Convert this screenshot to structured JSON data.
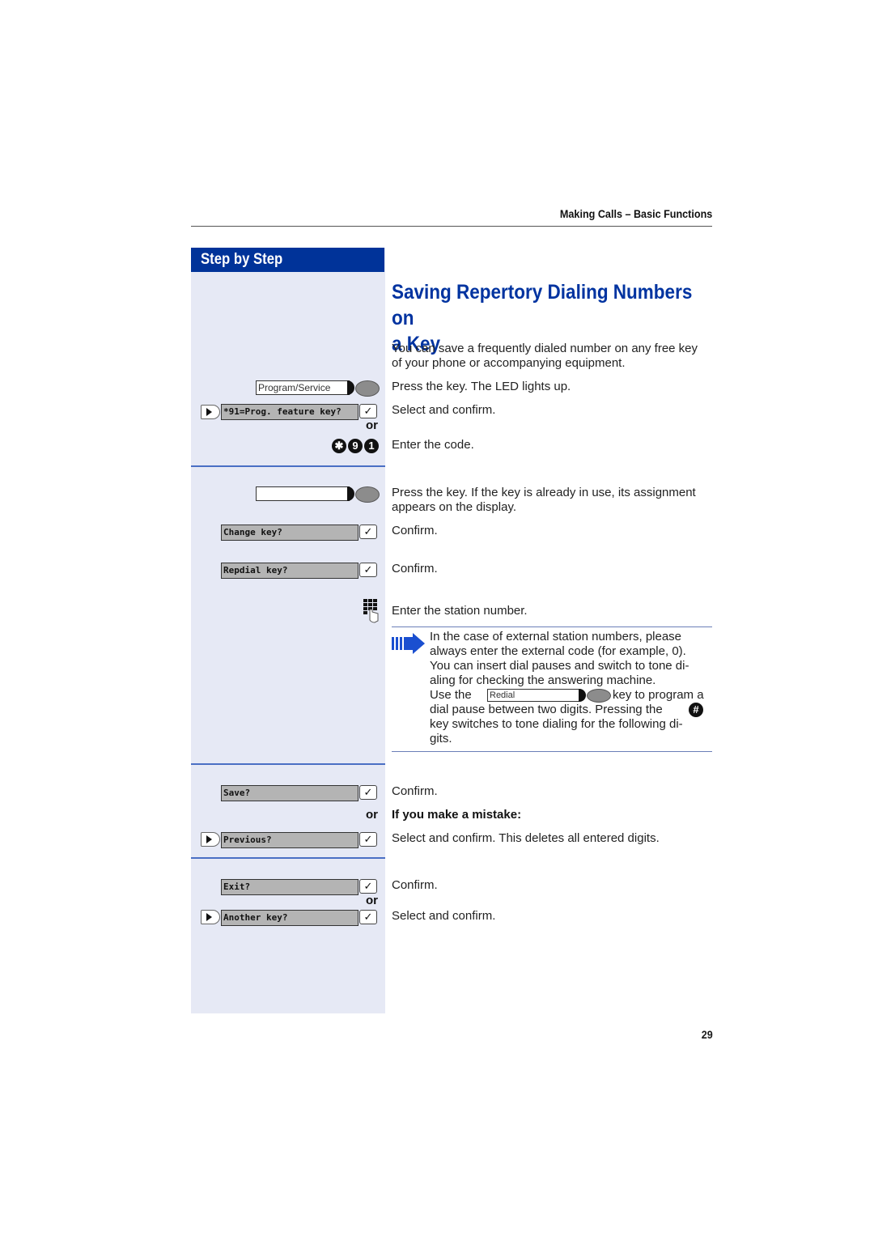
{
  "header": {
    "section_title": "Making Calls – Basic Functions"
  },
  "sidebar": {
    "heading": "Step by Step"
  },
  "page": {
    "title_line1": "Saving Repertory Dialing Numbers on",
    "title_line2": "a Key",
    "intro_line1": "You can save a frequently dialed number on any free key",
    "intro_line2": "of your phone or accompanying equipment.",
    "page_number": "29"
  },
  "steps": {
    "program_key_label": "Program/Service",
    "press_key_text": "Press the key. The LED lights up.",
    "lcd_prog_feature": "*91=Prog. feature key?",
    "select_confirm_1": "Select and confirm.",
    "or_1": "or",
    "code_digits": [
      "✱",
      "9",
      "1"
    ],
    "enter_code_text": "Enter the code.",
    "press_key_line1": "Press the key. If the key is already in use, its assignment",
    "press_key_line2": "appears on the display.",
    "lcd_change_key": "Change key?",
    "confirm_1": "Confirm.",
    "lcd_repdial_key": "Repdial key?",
    "confirm_2": "Confirm.",
    "enter_station_text": "Enter the station number.",
    "note_lines": [
      "In the case of external station numbers, please",
      "always enter the external code (for example, 0).",
      "You can insert dial pauses and switch to tone di-",
      "aling for checking the answering machine."
    ],
    "note_use_the": "Use the",
    "note_redial_label": "Redial",
    "note_key_to_program": "key to program a",
    "note_dial_pause": "dial pause between two digits. Pressing the",
    "note_key_switches": "key switches to tone dialing for the following di-",
    "note_gits": "gits.",
    "hash_symbol": "#",
    "lcd_save": "Save?",
    "confirm_3": "Confirm.",
    "or_2": "or",
    "mistake_heading": "If you make a mistake:",
    "lcd_previous": "Previous?",
    "select_confirm_delete": "Select and confirm. This deletes all entered digits.",
    "lcd_exit": "Exit?",
    "confirm_4": "Confirm.",
    "or_3": "or",
    "lcd_another_key": "Another key?",
    "select_confirm_2": "Select and confirm."
  },
  "colors": {
    "brand_blue": "#003399",
    "title_blue": "#0033a0",
    "sidebar_bg": "#e6e9f5",
    "separator": "#4a6fc4"
  }
}
